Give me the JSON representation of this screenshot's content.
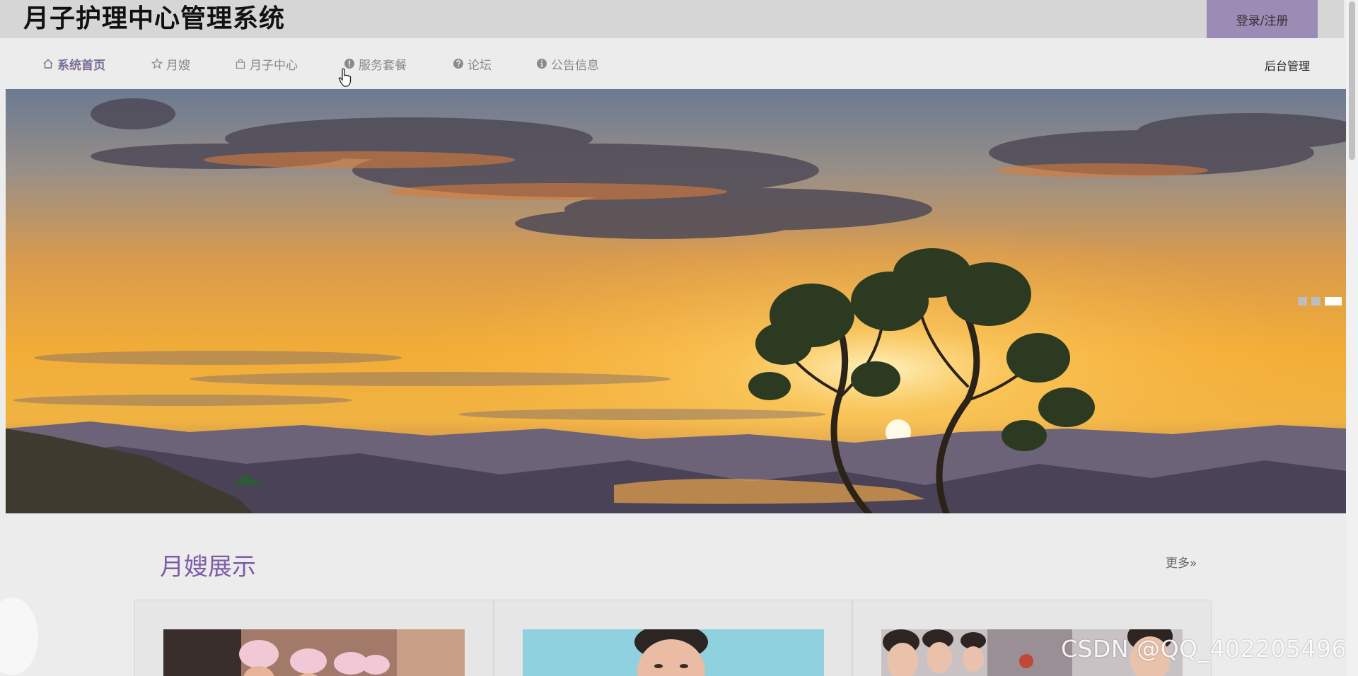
{
  "header": {
    "title": "月子护理中心管理系统",
    "login_label": "登录/注册"
  },
  "nav": {
    "items": [
      {
        "label": "系统首页",
        "icon": "home-icon",
        "active": true
      },
      {
        "label": "月嫂",
        "icon": "star-icon",
        "active": false
      },
      {
        "label": "月子中心",
        "icon": "bag-icon",
        "active": false
      },
      {
        "label": "服务套餐",
        "icon": "exclamation-circle-icon",
        "active": false
      },
      {
        "label": "论坛",
        "icon": "question-circle-icon",
        "active": false
      },
      {
        "label": "公告信息",
        "icon": "info-circle-icon",
        "active": false
      }
    ],
    "admin_label": "后台管理"
  },
  "banner": {
    "image": "sunset-mountains-tree",
    "slides": 3,
    "active_slide": 3
  },
  "section": {
    "title": "月嫂展示",
    "more_label": "更多»",
    "cards": [
      {
        "image": "nurses-group-photo"
      },
      {
        "image": "nurse-portrait-photo"
      },
      {
        "image": "staff-group-photo"
      }
    ]
  },
  "watermark": "CSDN @QQ_402205496",
  "colors": {
    "accent": "#7b5ea6",
    "login_bg": "#9b8bb5",
    "topbar_bg": "#d6d6d6",
    "page_bg": "#ececec"
  }
}
